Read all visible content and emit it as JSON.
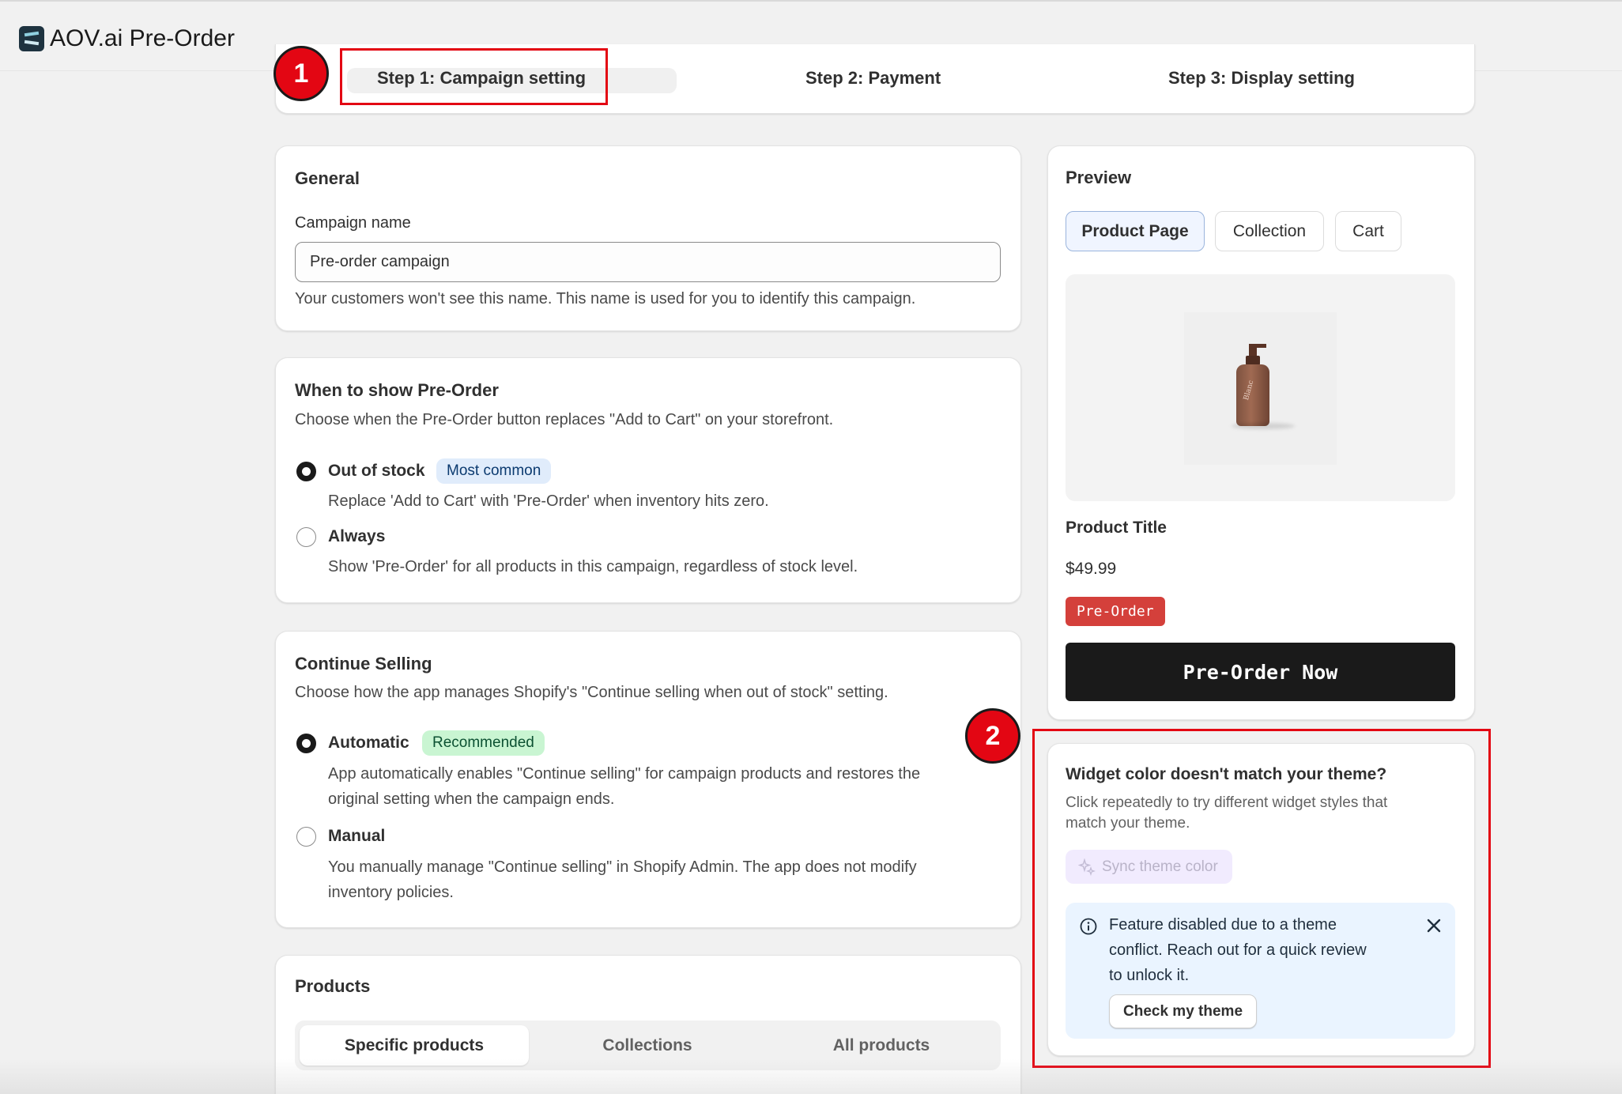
{
  "app": {
    "title": "AOV.ai Pre-Order"
  },
  "steps": [
    {
      "label": "Step 1: Campaign setting",
      "active": true
    },
    {
      "label": "Step 2: Payment",
      "active": false
    },
    {
      "label": "Step 3: Display setting",
      "active": false
    }
  ],
  "general": {
    "title": "General",
    "campaign_name_label": "Campaign name",
    "campaign_name_value": "Pre-order campaign",
    "help": "Your customers won't see this name. This name is used for you to identify this campaign."
  },
  "when_to_show": {
    "title": "When to show Pre-Order",
    "description": "Choose when the Pre-Order button replaces \"Add to Cart\" on your storefront.",
    "options": [
      {
        "label": "Out of stock",
        "badge": "Most common",
        "help": "Replace 'Add to Cart' with 'Pre-Order' when inventory hits zero.",
        "checked": true
      },
      {
        "label": "Always",
        "help": "Show 'Pre-Order' for all products in this campaign, regardless of stock level.",
        "checked": false
      }
    ]
  },
  "continue_selling": {
    "title": "Continue Selling",
    "description": "Choose how the app manages Shopify's \"Continue selling when out of stock\" setting.",
    "options": [
      {
        "label": "Automatic",
        "badge": "Recommended",
        "help_line1": "App automatically enables \"Continue selling\" for campaign products and restores the",
        "help_line2": "original setting when the campaign ends.",
        "checked": true
      },
      {
        "label": "Manual",
        "help_line1": "You manually manage \"Continue selling\" in Shopify Admin. The app does not modify",
        "help_line2": "inventory policies.",
        "checked": false
      }
    ]
  },
  "products": {
    "title": "Products",
    "tabs": [
      "Specific products",
      "Collections",
      "All products"
    ],
    "active_tab": "Specific products"
  },
  "preview": {
    "title": "Preview",
    "tabs": [
      "Product Page",
      "Collection",
      "Cart"
    ],
    "active_tab": "Product Page",
    "product_title": "Product Title",
    "price": "$49.99",
    "tag": "Pre-Order",
    "cta": "Pre-Order Now",
    "bottle_label": "Blanc"
  },
  "widget_color": {
    "title": "Widget color doesn't match your theme?",
    "description_line1": "Click repeatedly to try different widget styles that",
    "description_line2": "match your theme.",
    "sync_button": "Sync theme color",
    "banner_line1": "Feature disabled due to a theme",
    "banner_line2": "conflict. Reach out for a quick review",
    "banner_line3": "to unlock it.",
    "banner_button": "Check my theme"
  },
  "annotations": [
    "1",
    "2"
  ],
  "colors": {
    "annotation": "#e30613",
    "preorder_tag": "#d4403b",
    "cta_bg": "#1a1a1a",
    "banner_bg": "#eaf4ff"
  }
}
